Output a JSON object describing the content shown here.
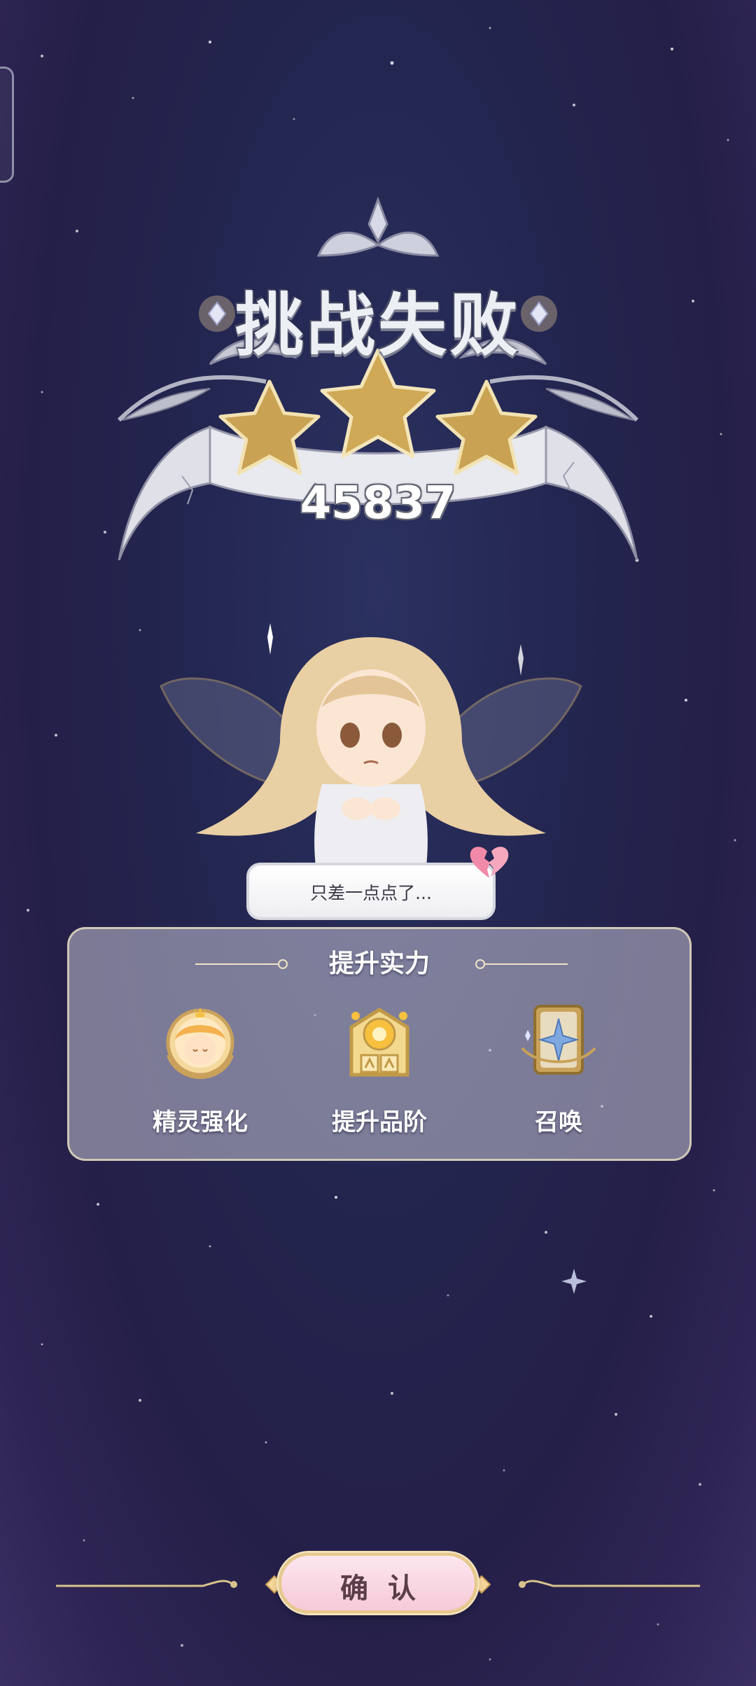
{
  "result": {
    "title": "挑战失败",
    "score": "45837",
    "stars_earned": 3,
    "stars_total": 3
  },
  "character": {
    "speech": "只差一点点了..."
  },
  "upgrade_panel": {
    "title": "提升实力",
    "items": [
      {
        "label": "精灵强化",
        "icon": "fairy-portrait-icon"
      },
      {
        "label": "提升品阶",
        "icon": "rank-up-icon"
      },
      {
        "label": "召唤",
        "icon": "summon-card-icon"
      }
    ]
  },
  "confirm": {
    "label": "确认"
  },
  "colors": {
    "background": "#252650",
    "star_gold": "#c9a253",
    "confirm_pink": "#f6c9d8",
    "panel_border": "#eee1c4"
  }
}
